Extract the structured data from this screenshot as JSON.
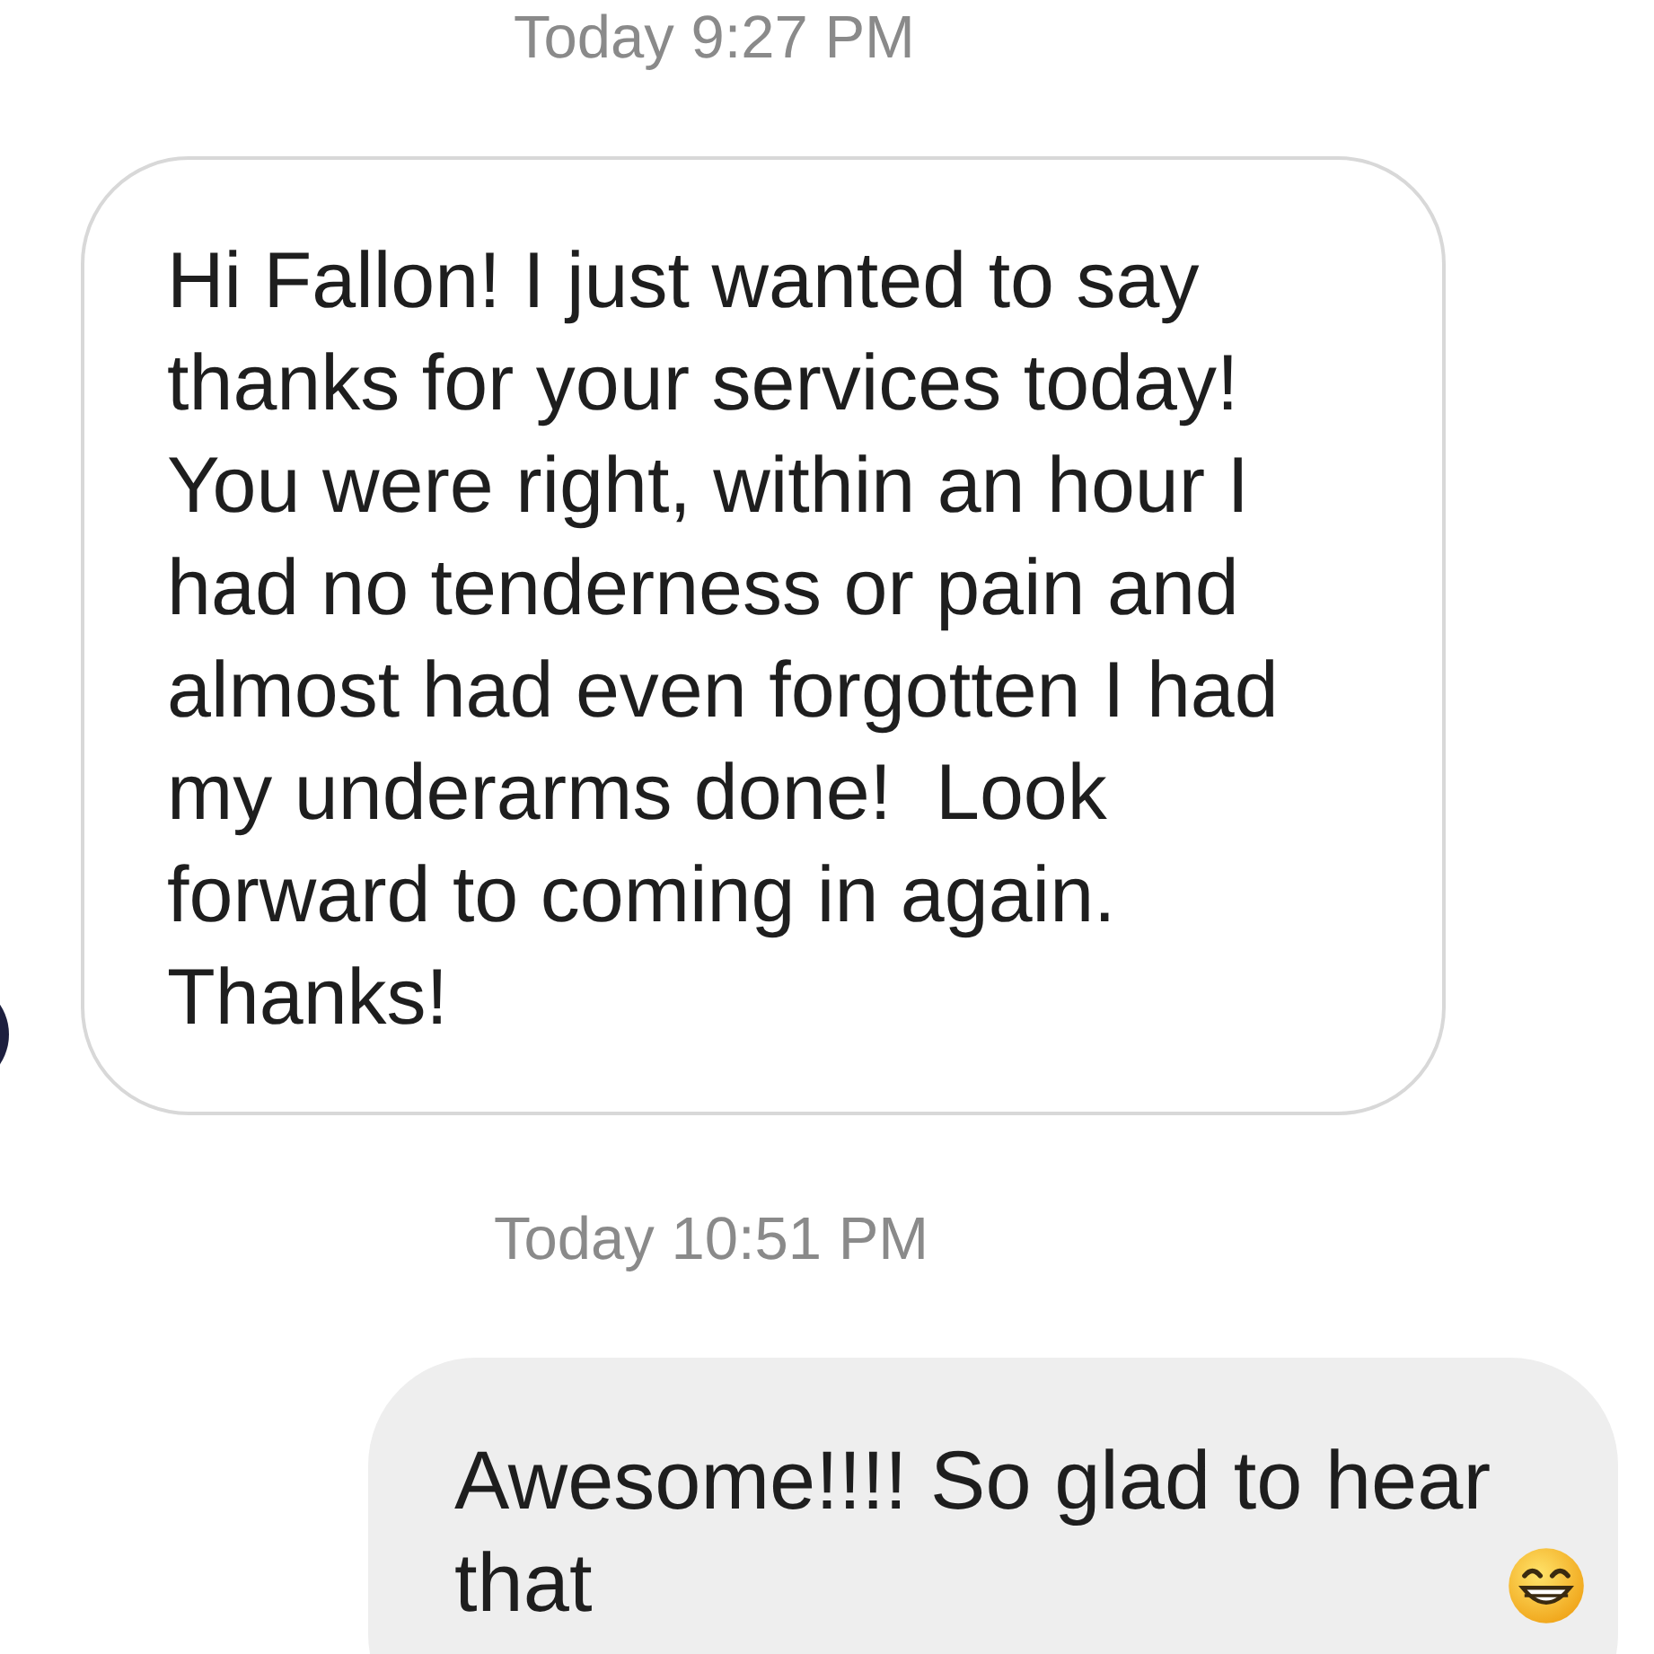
{
  "conversation": [
    {
      "kind": "timestamp",
      "text": "Today 9:27 PM"
    },
    {
      "kind": "received",
      "text": "Hi Fallon! I just wanted to say thanks for your services today! You were right, within an hour I had no tenderness or pain and almost had even forgotten I had my underarms done!  Look forward to coming in again. Thanks!"
    },
    {
      "kind": "timestamp",
      "text": "Today 10:51 PM"
    },
    {
      "kind": "sent",
      "text": "Awesome!!!! So glad to hear that"
    }
  ]
}
